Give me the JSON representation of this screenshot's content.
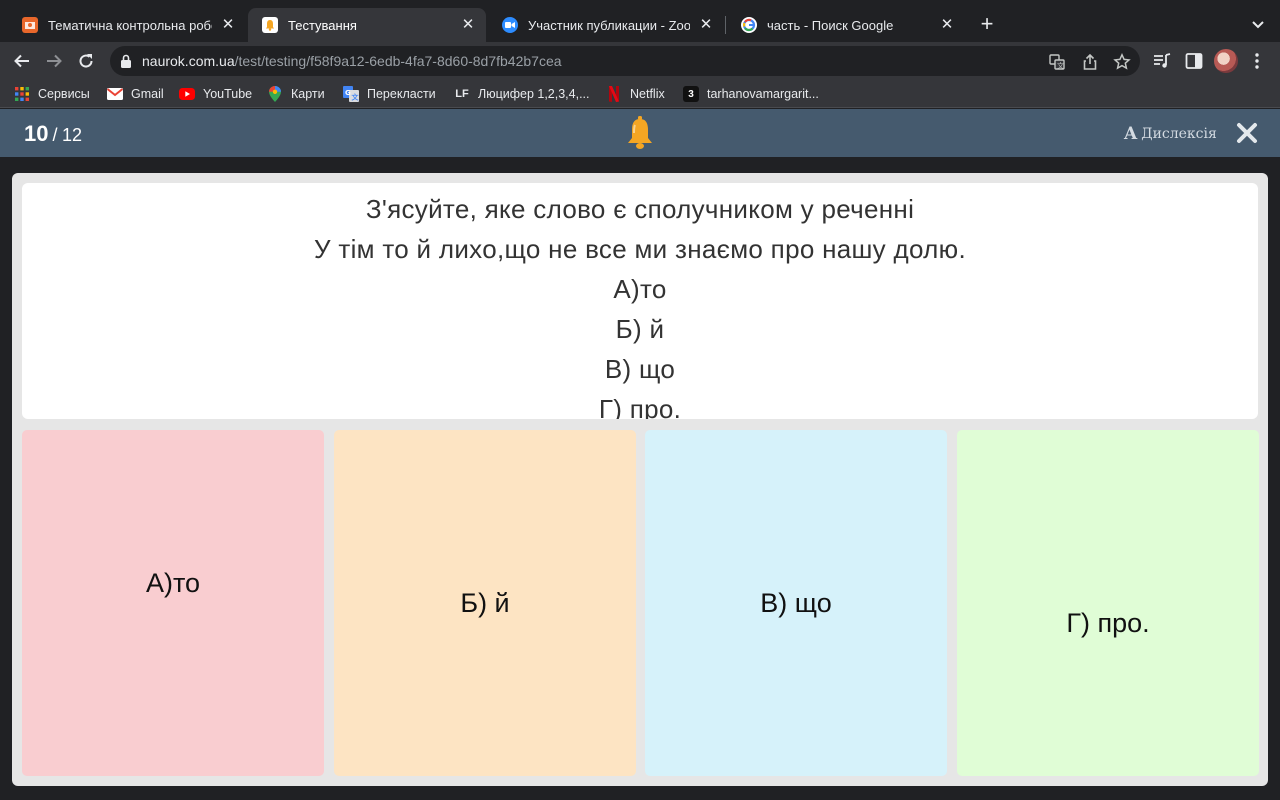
{
  "browser": {
    "tabs": [
      {
        "title": "Тематична контрольна робот",
        "favicon": "naurok-icon",
        "active": false
      },
      {
        "title": "Тестування",
        "favicon": "naurok-bell-icon",
        "active": true
      },
      {
        "title": "Участник публикации - Zoom",
        "favicon": "zoom-icon",
        "active": false
      },
      {
        "title": "часть - Поиск Google",
        "favicon": "google-icon",
        "active": false
      }
    ],
    "url": {
      "host": "naurok.com.ua",
      "path": "/test/testing/f58f9a12-6edb-4fa7-8d60-8d7fb42b7cea"
    },
    "bookmarks": [
      {
        "label": "Сервисы",
        "icon": "apps-grid-icon"
      },
      {
        "label": "Gmail",
        "icon": "gmail-icon"
      },
      {
        "label": "YouTube",
        "icon": "youtube-icon"
      },
      {
        "label": "Карти",
        "icon": "maps-icon"
      },
      {
        "label": "Перекласти",
        "icon": "translate-icon"
      },
      {
        "label": "Люцифер 1,2,3,4,...",
        "icon": "lf-icon"
      },
      {
        "label": "Netflix",
        "icon": "netflix-icon"
      },
      {
        "label": "tarhanovamargarit...",
        "icon": "z-icon"
      }
    ]
  },
  "app": {
    "progress": {
      "current": "10",
      "separator": "/",
      "total": "12"
    },
    "dyslexia": {
      "glyph": "A",
      "label": "Дислексія"
    },
    "header_color": "#455a6e"
  },
  "question": {
    "lines": [
      "З'ясуйте, яке слово є сполучником у реченні",
      "У тім то й лихо,що не все ми знаємо про нашу долю.",
      "А)то",
      "Б) й",
      "В) що",
      "Г) про."
    ]
  },
  "answers": [
    {
      "label": "А)то",
      "color": "#f9cdd0"
    },
    {
      "label": "Б) й",
      "color": "#fde4c3"
    },
    {
      "label": "В) що",
      "color": "#d6f2fa"
    },
    {
      "label": "Г) про.",
      "color": "#e0fdd6"
    }
  ]
}
